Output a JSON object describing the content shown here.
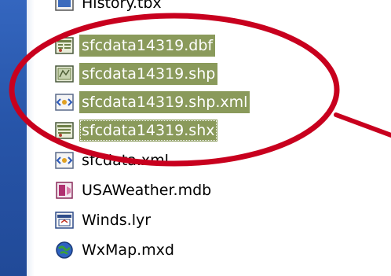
{
  "files": [
    {
      "label": "History.tbx",
      "icon": "toolbox-file-icon",
      "selected": false
    },
    {
      "label": "sfcdata14319.dbf",
      "icon": "dbf-table-file-icon",
      "selected": true
    },
    {
      "label": "sfcdata14319.shp",
      "icon": "shapefile-icon",
      "selected": true
    },
    {
      "label": "sfcdata14319.shp.xml",
      "icon": "xml-file-icon",
      "selected": true
    },
    {
      "label": "sfcdata14319.shx",
      "icon": "shx-file-icon",
      "selected": true,
      "focused": true
    },
    {
      "label": "sfcdata.xml",
      "icon": "xml-file-icon",
      "selected": false
    },
    {
      "label": "USAWeather.mdb",
      "icon": "access-database-icon",
      "selected": false
    },
    {
      "label": "Winds.lyr",
      "icon": "layer-file-icon",
      "selected": false
    },
    {
      "label": "WxMap.mxd",
      "icon": "arcmap-document-icon",
      "selected": false
    }
  ],
  "colors": {
    "background": "#2a57a8",
    "selection": "#8a9a5b",
    "annotation": "#c8001e"
  }
}
